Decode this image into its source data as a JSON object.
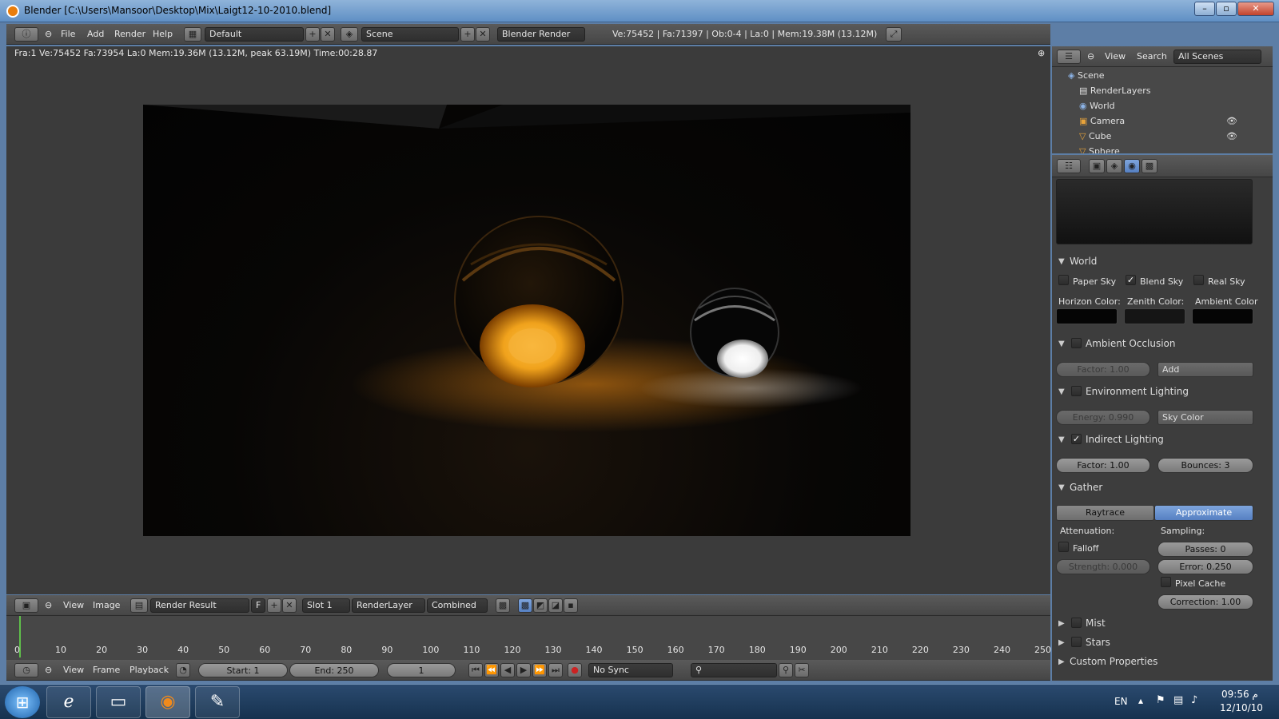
{
  "window": {
    "title": "Blender [C:\\Users\\Mansoor\\Desktop\\Mix\\Laigt12-10-2010.blend]"
  },
  "info_header": {
    "menus": [
      "File",
      "Add",
      "Render",
      "Help"
    ],
    "screen_layout": "Default",
    "scene": "Scene",
    "render_engine": "Blender Render",
    "stats": "Ve:75452 | Fa:71397 | Ob:0-4 | La:0 | Mem:19.38M (13.12M)"
  },
  "image_editor": {
    "render_info": "Fra:1  Ve:75452 Fa:73954 La:0 Mem:19.36M (13.12M, peak 63.19M) Time:00:28.87",
    "menus": [
      "View",
      "Image"
    ],
    "image_name": "Render Result",
    "fake_user": "F",
    "slot": "Slot 1",
    "render_layer": "RenderLayer",
    "pass": "Combined"
  },
  "outliner": {
    "menus": [
      "View",
      "Search"
    ],
    "display_mode": "All Scenes",
    "items": [
      "Scene",
      "RenderLayers",
      "World",
      "Camera",
      "Cube",
      "Sphere"
    ]
  },
  "properties": {
    "world_panel": {
      "title": "World",
      "paper_sky": "Paper Sky",
      "blend_sky": "Blend Sky",
      "real_sky": "Real Sky",
      "horizon_color": "Horizon Color:",
      "zenith_color": "Zenith Color:",
      "ambient_color": "Ambient Color"
    },
    "ao_panel": {
      "title": "Ambient Occlusion",
      "factor": "Factor: 1.00",
      "blend": "Add"
    },
    "env_panel": {
      "title": "Environment Lighting",
      "energy": "Energy: 0.990",
      "source": "Sky Color"
    },
    "indirect_panel": {
      "title": "Indirect Lighting",
      "factor": "Factor: 1.00",
      "bounces": "Bounces: 3"
    },
    "gather_panel": {
      "title": "Gather",
      "raytrace": "Raytrace",
      "approximate": "Approximate",
      "attenuation": "Attenuation:",
      "sampling": "Sampling:",
      "falloff": "Falloff",
      "passes": "Passes: 0",
      "strength": "Strength: 0.000",
      "error": "Error: 0.250",
      "pixel_cache": "Pixel Cache",
      "correction": "Correction: 1.00"
    },
    "mist_panel": {
      "title": "Mist"
    },
    "stars_panel": {
      "title": "Stars"
    },
    "custom_panel": {
      "title": "Custom Properties"
    }
  },
  "timeline": {
    "ticks": [
      "0",
      "10",
      "20",
      "30",
      "40",
      "50",
      "60",
      "70",
      "80",
      "90",
      "100",
      "110",
      "120",
      "130",
      "140",
      "150",
      "160",
      "170",
      "180",
      "190",
      "200",
      "210",
      "220",
      "230",
      "240",
      "250"
    ],
    "menus": [
      "View",
      "Frame",
      "Playback"
    ],
    "start": "Start: 1",
    "end": "End: 250",
    "current": "1",
    "sync": "No Sync"
  },
  "taskbar": {
    "lang": "EN",
    "time": "09:56 م",
    "date": "12/10/10"
  },
  "colors": {
    "accent_blue": "#5680c2",
    "orange_glow": "#f0a21c"
  }
}
